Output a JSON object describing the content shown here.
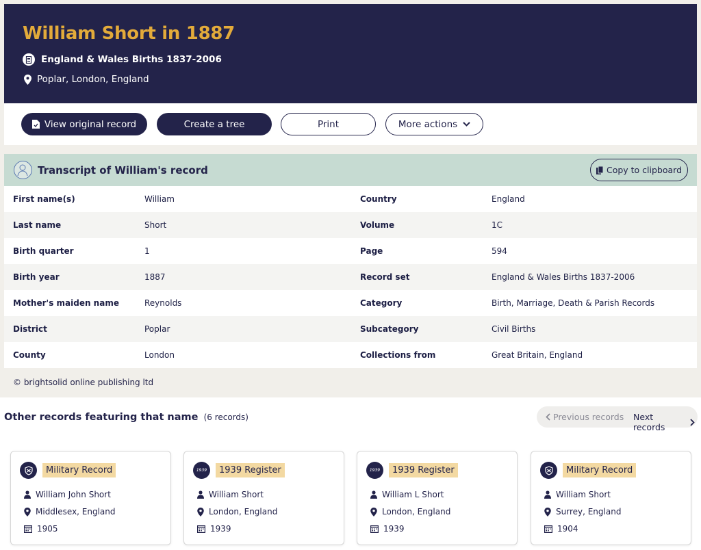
{
  "header": {
    "title": "William Short in 1887",
    "collection": "England & Wales Births 1837-2006",
    "location": "Poplar, London, England"
  },
  "actions": {
    "view_original": "View original record",
    "create_tree": "Create a tree",
    "print": "Print",
    "more_actions": "More actions"
  },
  "transcript": {
    "title": "Transcript of William's record",
    "copy_label": "Copy to clipboard",
    "rows": [
      {
        "label1": "First name(s)",
        "value1": "William",
        "label2": "Country",
        "value2": "England"
      },
      {
        "label1": "Last name",
        "value1": "Short",
        "label2": "Volume",
        "value2": "1C"
      },
      {
        "label1": "Birth quarter",
        "value1": "1",
        "label2": "Page",
        "value2": "594"
      },
      {
        "label1": "Birth year",
        "value1": "1887",
        "label2": "Record set",
        "value2": "England & Wales Births 1837-2006"
      },
      {
        "label1": "Mother's maiden name",
        "value1": "Reynolds",
        "label2": "Category",
        "value2": "Birth, Marriage, Death & Parish Records"
      },
      {
        "label1": "District",
        "value1": "Poplar",
        "label2": "Subcategory",
        "value2": "Civil Births"
      },
      {
        "label1": "County",
        "value1": "London",
        "label2": "Collections from",
        "value2": "Great Britain, England"
      }
    ],
    "copyright": "© brightsolid online publishing ltd"
  },
  "other": {
    "title": "Other records featuring that name",
    "count": "(6 records)",
    "prev_label": "Previous records",
    "next_label": "Next records",
    "cards": [
      {
        "icon": "military-icon",
        "icon_text": "",
        "type": "Military Record",
        "name": "William John Short",
        "place": "Middlesex, England",
        "year": "1905"
      },
      {
        "icon": "register-1939-icon",
        "icon_text": "1939",
        "type": "1939 Register",
        "name": "William Short",
        "place": "London, England",
        "year": "1939"
      },
      {
        "icon": "register-1939-icon",
        "icon_text": "1939",
        "type": "1939 Register",
        "name": "William L Short",
        "place": "London, England",
        "year": "1939"
      },
      {
        "icon": "military-icon",
        "icon_text": "",
        "type": "Military Record",
        "name": "William Short",
        "place": "Surrey, England",
        "year": "1904"
      }
    ]
  },
  "colors": {
    "navy": "#23234a",
    "gold": "#e3ab3a",
    "mint": "#c6dbd2",
    "tag": "#f3d9a2"
  }
}
